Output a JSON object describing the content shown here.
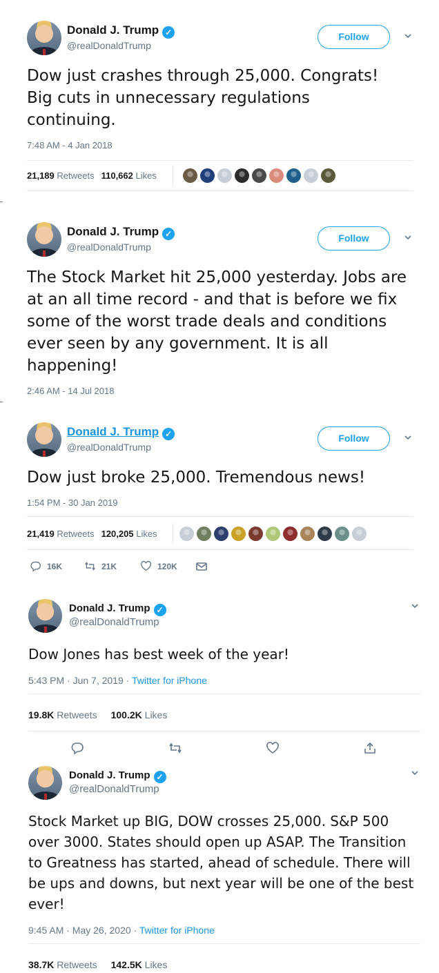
{
  "tweets": [
    {
      "name": "Donald J. Trump",
      "handle": "@realDonaldTrump",
      "follow_label": "Follow",
      "text": "Dow just crashes through 25,000. Congrats! Big cuts in unnecessary regulations continuing.",
      "time": "7:48 AM - 4 Jan 2018",
      "retweets_count": "21,189",
      "retweets_label": "Retweets",
      "likes_count": "110,662",
      "likes_label": "Likes"
    },
    {
      "name": "Donald J. Trump",
      "handle": "@realDonaldTrump",
      "follow_label": "Follow",
      "text": "The Stock Market hit 25,000 yesterday. Jobs are at an all time record - and that is before we fix some of the worst trade deals and conditions ever seen by any government. It is all happening!",
      "time": "2:46 AM - 14 Jul 2018"
    },
    {
      "name": "Donald J. Trump",
      "handle": "@realDonaldTrump",
      "follow_label": "Follow",
      "text": "Dow just broke 25,000. Tremendous news!",
      "time": "1:54 PM - 30 Jan 2019",
      "retweets_count": "21,419",
      "retweets_label": "Retweets",
      "likes_count": "120,205",
      "likes_label": "Likes",
      "reply_count": "16K",
      "retweet_count_short": "21K",
      "like_count_short": "120K"
    },
    {
      "name": "Donald J. Trump",
      "handle": "@realDonaldTrump",
      "text": "Dow Jones has best week of the year!",
      "time": "5:43 PM · Jun 7, 2019 · ",
      "source": "Twitter for iPhone",
      "retweets_count": "19.8K",
      "retweets_label": "Retweets",
      "likes_count": "100.2K",
      "likes_label": "Likes"
    },
    {
      "name": "Donald J. Trump",
      "handle": "@realDonaldTrump",
      "text": "Stock Market up BIG, DOW crosses 25,000. S&P 500 over 3000. States should open up ASAP. The Transition to Greatness has started, ahead of schedule. There will be ups and downs, but next year will be one of the best ever!",
      "time": "9:45 AM · May 26, 2020 · ",
      "source": "Twitter for iPhone",
      "retweets_count": "38.7K",
      "retweets_label": "Retweets",
      "likes_count": "142.5K",
      "likes_label": "Likes"
    }
  ],
  "icons": {
    "verified": "verified-badge-icon",
    "chevron": "chevron-down-icon",
    "reply": "reply-icon",
    "retweet": "retweet-icon",
    "like": "heart-icon",
    "dm": "envelope-icon",
    "share": "share-icon"
  },
  "colors": {
    "accent": "#1da1f2",
    "link": "#1b95e0",
    "muted": "#657786",
    "text": "#14171a",
    "divider": "#e6ecf0"
  },
  "liker_avatar_colors_1": [
    "#6b5b45",
    "#1f3f7a",
    "#c7ced6",
    "#2b2b2b",
    "#4a4a4a",
    "#d98b7c",
    "#1e5f8c",
    "#c7ced6",
    "#5a5a3a"
  ],
  "liker_avatar_colors_2": [
    "#c7ced6",
    "#6f7f5f",
    "#2c3e6b",
    "#c9a227",
    "#7a3b2e",
    "#b0c878",
    "#8f2d2d",
    "#a8845a",
    "#2e3b48",
    "#6b8f8a",
    "#c7ced6"
  ]
}
